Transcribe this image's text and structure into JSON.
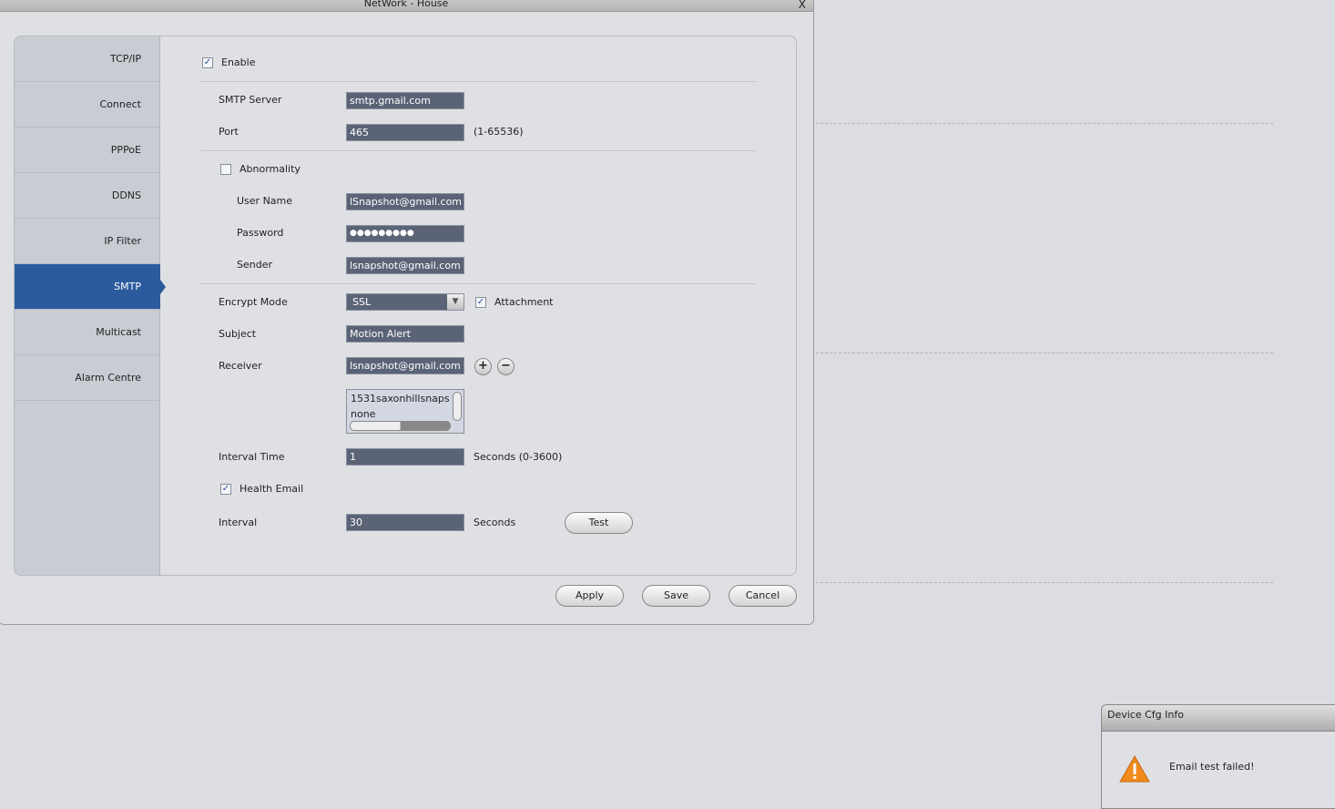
{
  "window": {
    "title": "NetWork - House",
    "close": "X"
  },
  "sidebar": {
    "items": [
      {
        "label": "TCP/IP"
      },
      {
        "label": "Connect"
      },
      {
        "label": "PPPoE"
      },
      {
        "label": "DDNS"
      },
      {
        "label": "IP Filter"
      },
      {
        "label": "SMTP",
        "active": true
      },
      {
        "label": "Multicast"
      },
      {
        "label": "Alarm Centre"
      }
    ]
  },
  "form": {
    "enable": {
      "label": "Enable",
      "checked": true
    },
    "smtp_server": {
      "label": "SMTP Server",
      "value": "smtp.gmail.com"
    },
    "port": {
      "label": "Port",
      "value": "465",
      "hint": "(1-65536)"
    },
    "abnormality": {
      "label": "Abnormality",
      "checked": false
    },
    "user_name": {
      "label": "User Name",
      "value": "lSnapshot@gmail.com"
    },
    "password": {
      "label": "Password",
      "value": "●●●●●●●●●"
    },
    "sender": {
      "label": "Sender",
      "value": "lsnapshot@gmail.com"
    },
    "encrypt_mode": {
      "label": "Encrypt Mode",
      "value": "SSL"
    },
    "attachment": {
      "label": "Attachment",
      "checked": true
    },
    "subject": {
      "label": "Subject",
      "value": "Motion Alert"
    },
    "receiver": {
      "label": "Receiver",
      "value": "lsnapshot@gmail.com",
      "list": [
        "1531saxonhillsnaps",
        "none"
      ]
    },
    "interval_time": {
      "label": "Interval Time",
      "value": "1",
      "hint": "Seconds (0-3600)"
    },
    "health_email": {
      "label": "Health Email",
      "checked": true
    },
    "interval": {
      "label": "Interval",
      "value": "30",
      "hint": "Seconds"
    },
    "test_label": "Test"
  },
  "footer": {
    "apply": "Apply",
    "save": "Save",
    "cancel": "Cancel"
  },
  "popup": {
    "title": "Device Cfg Info",
    "message": "Email test failed!",
    "icon": "warning-icon"
  },
  "colors": {
    "accent": "#2b5b9c",
    "field": "#5b6376"
  }
}
